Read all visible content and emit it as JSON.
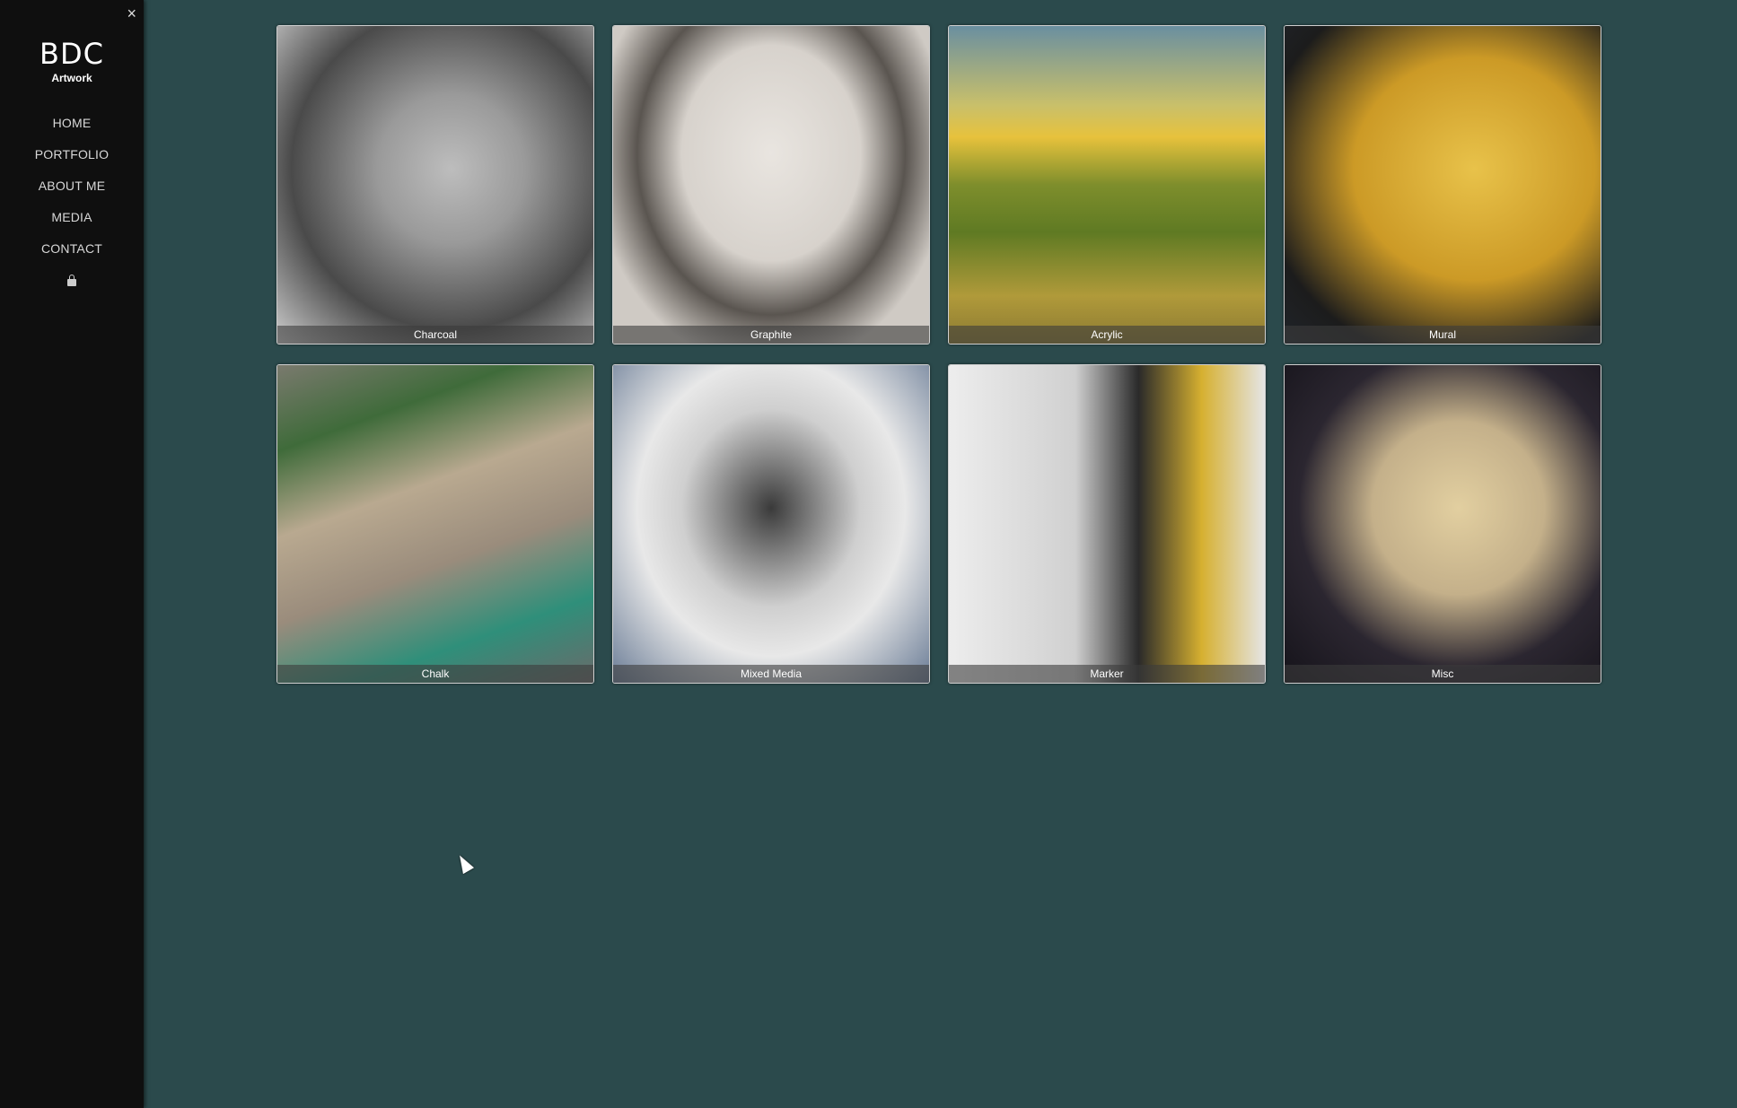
{
  "sidebar": {
    "close_label": "×",
    "brand_title": "BDC",
    "brand_subtitle": "Artwork",
    "nav": [
      {
        "label": "HOME"
      },
      {
        "label": "PORTFOLIO"
      },
      {
        "label": "ABOUT ME"
      },
      {
        "label": "MEDIA"
      },
      {
        "label": "CONTACT"
      }
    ],
    "lock_icon": "lock-icon"
  },
  "gallery": {
    "tiles": [
      {
        "caption": "Charcoal"
      },
      {
        "caption": "Graphite"
      },
      {
        "caption": "Acrylic"
      },
      {
        "caption": "Mural"
      },
      {
        "caption": "Chalk"
      },
      {
        "caption": "Mixed Media"
      },
      {
        "caption": "Marker"
      },
      {
        "caption": "Misc"
      }
    ]
  },
  "colors": {
    "page_background": "#2b4a4c",
    "sidebar_background": "#0f0f0f"
  }
}
